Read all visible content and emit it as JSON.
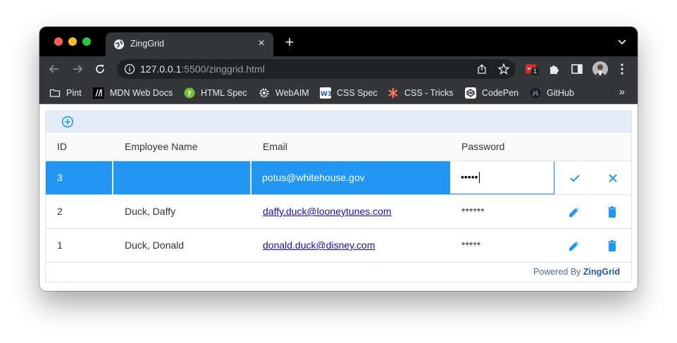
{
  "browser": {
    "tab_title": "ZingGrid",
    "new_tab_label": "+",
    "tab_close_label": "×",
    "url_host": "127.0.0.1",
    "url_rest": ":5500/zinggrid.html",
    "extension_badge_count": "1",
    "bookmarks": [
      {
        "label": "Pint",
        "icon": "folder-icon"
      },
      {
        "label": "MDN Web Docs",
        "icon": "mdn-icon"
      },
      {
        "label": "HTML Spec",
        "icon": "whatwg-icon"
      },
      {
        "label": "WebAIM",
        "icon": "webaim-gear-icon"
      },
      {
        "label": "CSS Spec",
        "icon": "w3c-icon"
      },
      {
        "label": "CSS - Tricks",
        "icon": "css-tricks-star-icon"
      },
      {
        "label": "CodePen",
        "icon": "codepen-icon"
      },
      {
        "label": "GitHub",
        "icon": "github-icon"
      }
    ],
    "bookmarks_more_label": "»"
  },
  "grid": {
    "headers": {
      "id": "ID",
      "name": "Employee Name",
      "email": "Email",
      "password": "Password"
    },
    "editing_row": {
      "id": "3",
      "name": "",
      "email": "potus@whitehouse.gov",
      "password": "•••••"
    },
    "rows": [
      {
        "id": "2",
        "name": "Duck, Daffy",
        "email": "daffy.duck@looneytunes.com",
        "password": "******"
      },
      {
        "id": "1",
        "name": "Duck, Donald",
        "email": "donald.duck@disney.com",
        "password": "*****"
      }
    ],
    "footer_prefix": "Powered By",
    "footer_brand": "ZingGrid"
  },
  "colors": {
    "accent": "#2196f3",
    "caption_bg": "#e3ecf7",
    "chrome_dark": "#35363a"
  }
}
